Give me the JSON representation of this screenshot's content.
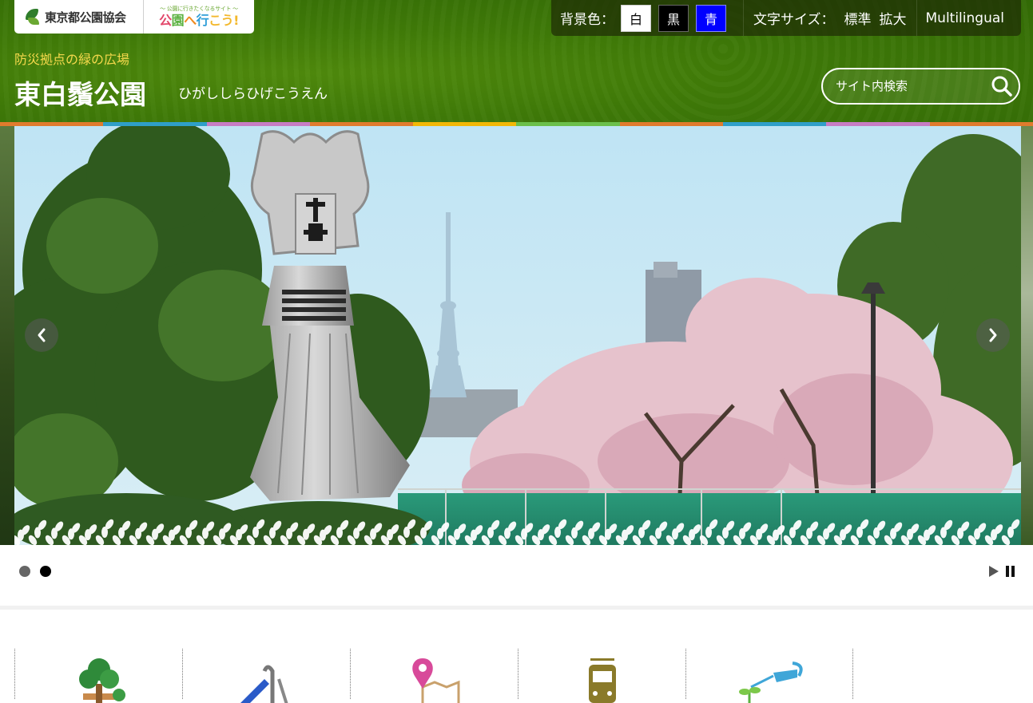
{
  "header": {
    "logo_org": "東京都公園協会",
    "logo_tagline": "〜 公園に行きたくなるサイト 〜",
    "logo_brand_parts": [
      "公",
      "園",
      "へ",
      "行",
      "こう!"
    ],
    "subtitle": "防災拠点の緑の広場",
    "park_name": "東白鬚公園",
    "park_reading": "ひがししらひげこうえん"
  },
  "utility": {
    "bg_color_label": "背景色：",
    "bg_options": [
      "白",
      "黒",
      "青"
    ],
    "font_size_label": "文字サイズ：",
    "font_size_options": [
      "標準",
      "拡大"
    ],
    "multilingual": "Multilingual"
  },
  "search": {
    "placeholder": "サイト内検索"
  },
  "stripe_colors": [
    "#e07b2d",
    "#2f9fc8",
    "#c77dc4",
    "#e07b2d",
    "#f2b705",
    "#6bbf4a",
    "#e07b2d",
    "#2f9fc8",
    "#c77dc4",
    "#e07b2d"
  ],
  "slider": {
    "slide_count": 2,
    "active_slide": 2
  },
  "categories": [
    {
      "name": "tree-icon"
    },
    {
      "name": "playground-slide-icon"
    },
    {
      "name": "map-pin-icon"
    },
    {
      "name": "train-icon"
    },
    {
      "name": "watering-can-icon"
    }
  ]
}
